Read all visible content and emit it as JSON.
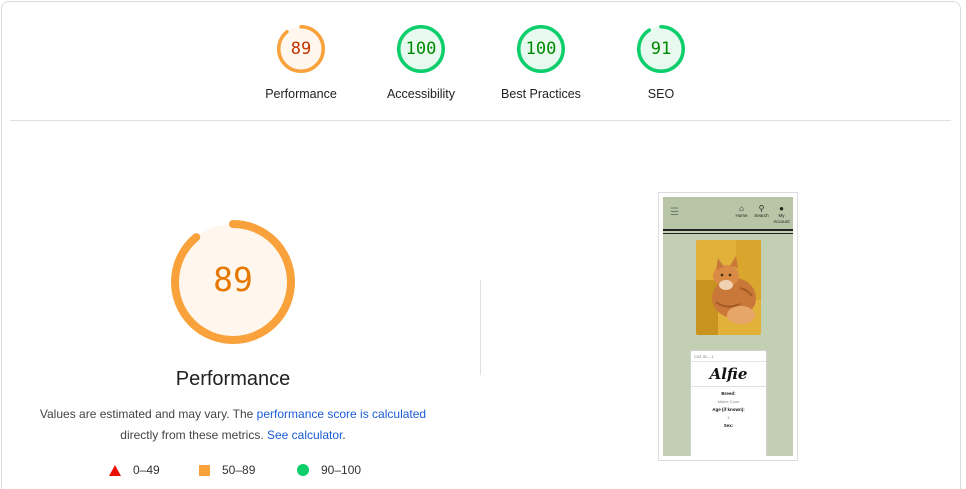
{
  "gauges": [
    {
      "label": "Performance",
      "score": "89",
      "fraction": 0.89,
      "color": "#f9a23b",
      "text_color": "#c33300",
      "bg": "#fff7ee"
    },
    {
      "label": "Accessibility",
      "score": "100",
      "fraction": 1.0,
      "color": "#0cce6b",
      "text_color": "#008800",
      "bg": "#e8faf0"
    },
    {
      "label": "Best Practices",
      "score": "100",
      "fraction": 1.0,
      "color": "#0cce6b",
      "text_color": "#008800",
      "bg": "#e8faf0"
    },
    {
      "label": "SEO",
      "score": "91",
      "fraction": 0.91,
      "color": "#0cce6b",
      "text_color": "#008800",
      "bg": "#e8faf0"
    }
  ],
  "main": {
    "score": "89",
    "fraction": 0.89,
    "title": "Performance",
    "desc_prefix": "Values are estimated and may vary. The ",
    "desc_link1": "performance score is calculated",
    "desc_mid": " directly from these metrics. ",
    "desc_link2": "See calculator",
    "desc_suffix": "."
  },
  "legend": {
    "fail": "0–49",
    "average": "50–89",
    "pass": "90–100"
  },
  "screenshot": {
    "nav": {
      "home": "Home",
      "search": "Search",
      "account": "My Account"
    },
    "card": {
      "cat_id": "CAT ID – 1",
      "name": "Alfie",
      "breed_label": "Breed:",
      "breed_value": "Maine Coon",
      "age_label": "Age (if known):",
      "age_value": "4",
      "sex_label": "Sex:"
    }
  },
  "colors": {
    "link": "#1a5cd6",
    "average": "#f9a23b",
    "pass": "#0cce6b",
    "fail": "#eb0f00"
  }
}
